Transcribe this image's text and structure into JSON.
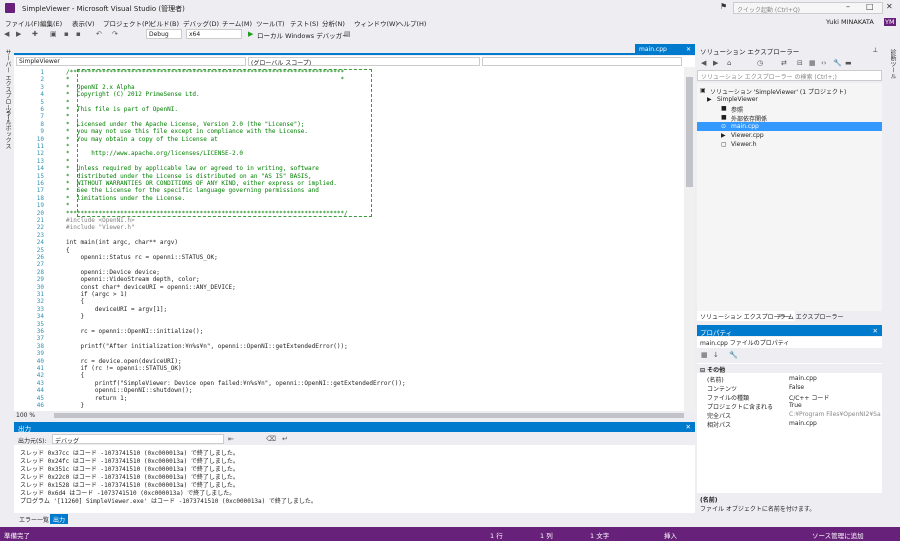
{
  "window": {
    "title": "SimpleViewer - Microsoft Visual Studio (管理者)",
    "quick_launch": "クイック起動 (Ctrl+Q)",
    "user": "Yuki MINAKATA",
    "user_initials": "YM"
  },
  "menu": [
    "ファイル(F)",
    "編集(E)",
    "表示(V)",
    "プロジェクト(P)",
    "ビルド(B)",
    "デバッグ(D)",
    "チーム(M)",
    "ツール(T)",
    "テスト(S)",
    "分析(N)",
    "ウィンドウ(W)",
    "ヘルプ(H)"
  ],
  "toolbar": {
    "config": "Debug",
    "platform": "x64",
    "run": "ローカル Windows デバッガー"
  },
  "left_strip": [
    "サーバー エクスプローラー",
    "ツールボックス"
  ],
  "right_strip": [
    "診断ツール"
  ],
  "editor": {
    "tab": "main.cpp",
    "nav_project": "SimpleViewer",
    "nav_scope": "(グローバル スコープ)",
    "zoom": "100 %"
  },
  "code_lines": [
    {
      "n": "1",
      "t": "/****************************************************************************",
      "c": "cmt"
    },
    {
      "n": "2",
      "t": "*                                                                           *",
      "c": "cmt"
    },
    {
      "n": "3",
      "t": "*  OpenNI 2.x Alpha",
      "c": "cmt"
    },
    {
      "n": "4",
      "t": "*  Copyright (C) 2012 PrimeSense Ltd.",
      "c": "cmt"
    },
    {
      "n": "5",
      "t": "*",
      "c": "cmt"
    },
    {
      "n": "6",
      "t": "*  This file is part of OpenNI.",
      "c": "cmt"
    },
    {
      "n": "7",
      "t": "*",
      "c": "cmt"
    },
    {
      "n": "8",
      "t": "*  Licensed under the Apache License, Version 2.0 (the \"License\");",
      "c": "cmt"
    },
    {
      "n": "9",
      "t": "*  you may not use this file except in compliance with the License.",
      "c": "cmt"
    },
    {
      "n": "10",
      "t": "*  You may obtain a copy of the License at",
      "c": "cmt"
    },
    {
      "n": "11",
      "t": "*",
      "c": "cmt"
    },
    {
      "n": "12",
      "t": "*      http://www.apache.org/licenses/LICENSE-2.0",
      "c": "cmt"
    },
    {
      "n": "13",
      "t": "*",
      "c": "cmt"
    },
    {
      "n": "14",
      "t": "*  Unless required by applicable law or agreed to in writing, software",
      "c": "cmt"
    },
    {
      "n": "15",
      "t": "*  distributed under the License is distributed on an \"AS IS\" BASIS,",
      "c": "cmt"
    },
    {
      "n": "16",
      "t": "*  WITHOUT WARRANTIES OR CONDITIONS OF ANY KIND, either express or implied.",
      "c": "cmt"
    },
    {
      "n": "17",
      "t": "*  See the License for the specific language governing permissions and",
      "c": "cmt"
    },
    {
      "n": "18",
      "t": "*  limitations under the License.",
      "c": "cmt"
    },
    {
      "n": "19",
      "t": "*",
      "c": "cmt"
    },
    {
      "n": "20",
      "t": "*****************************************************************************/",
      "c": "cmt"
    },
    {
      "n": "21",
      "t": "#include <OpenNI.h>",
      "c": "pp"
    },
    {
      "n": "22",
      "t": "#include \"Viewer.h\"",
      "c": "pp"
    },
    {
      "n": "23",
      "t": "",
      "c": ""
    },
    {
      "n": "24",
      "t": "int main(int argc, char** argv)",
      "c": ""
    },
    {
      "n": "25",
      "t": "{",
      "c": ""
    },
    {
      "n": "26",
      "t": "    openni::Status rc = openni::STATUS_OK;",
      "c": ""
    },
    {
      "n": "27",
      "t": "",
      "c": ""
    },
    {
      "n": "28",
      "t": "    openni::Device device;",
      "c": ""
    },
    {
      "n": "29",
      "t": "    openni::VideoStream depth, color;",
      "c": ""
    },
    {
      "n": "30",
      "t": "    const char* deviceURI = openni::ANY_DEVICE;",
      "c": ""
    },
    {
      "n": "31",
      "t": "    if (argc > 1)",
      "c": ""
    },
    {
      "n": "32",
      "t": "    {",
      "c": ""
    },
    {
      "n": "33",
      "t": "        deviceURI = argv[1];",
      "c": ""
    },
    {
      "n": "34",
      "t": "    }",
      "c": ""
    },
    {
      "n": "35",
      "t": "",
      "c": ""
    },
    {
      "n": "36",
      "t": "    rc = openni::OpenNI::initialize();",
      "c": ""
    },
    {
      "n": "37",
      "t": "",
      "c": ""
    },
    {
      "n": "38",
      "t": "    printf(\"After initialization:¥n%s¥n\", openni::OpenNI::getExtendedError());",
      "c": ""
    },
    {
      "n": "39",
      "t": "",
      "c": ""
    },
    {
      "n": "40",
      "t": "    rc = device.open(deviceURI);",
      "c": ""
    },
    {
      "n": "41",
      "t": "    if (rc != openni::STATUS_OK)",
      "c": ""
    },
    {
      "n": "42",
      "t": "    {",
      "c": ""
    },
    {
      "n": "43",
      "t": "        printf(\"SimpleViewer: Device open failed:¥n%s¥n\", openni::OpenNI::getExtendedError());",
      "c": ""
    },
    {
      "n": "44",
      "t": "        openni::OpenNI::shutdown();",
      "c": ""
    },
    {
      "n": "45",
      "t": "        return 1;",
      "c": ""
    },
    {
      "n": "46",
      "t": "    }",
      "c": ""
    }
  ],
  "output": {
    "title": "出力",
    "source_label": "出力元(S):",
    "source": "デバッグ",
    "lines": [
      "スレッド 0x37cc はコード -1073741510 (0xc000013a) で終了しました。",
      "スレッド 0x24fc はコード -1073741510 (0xc000013a) で終了しました。",
      "スレッド 0x351c はコード -1073741510 (0xc000013a) で終了しました。",
      "スレッド 0x22c0 はコード -1073741510 (0xc000013a) で終了しました。",
      "スレッド 0x1528 はコード -1073741510 (0xc000013a) で終了しました。",
      "スレッド 0x6d4 はコード -1073741510 (0xc000013a) で終了しました。",
      "プログラム '[11260] SimpleViewer.exe' はコード -1073741510 (0xc000013a) で終了しました。"
    ]
  },
  "bottom_tabs": [
    "エラー一覧",
    "出力"
  ],
  "solution_explorer": {
    "title": "ソリューション エクスプローラー",
    "search": "ソリューション エクスプローラー の検索 (Ctrl+;)",
    "items": [
      {
        "label": "ソリューション 'SimpleViewer' (1 プロジェクト)",
        "indent": 0
      },
      {
        "label": "SimpleViewer",
        "indent": 1
      },
      {
        "label": "参照",
        "indent": 2
      },
      {
        "label": "外部依存関係",
        "indent": 2
      },
      {
        "label": "main.cpp",
        "indent": 2
      },
      {
        "label": "Viewer.cpp",
        "indent": 2
      },
      {
        "label": "Viewer.h",
        "indent": 2
      }
    ],
    "tabs": [
      "ソリューション エクスプローラー",
      "チーム エクスプローラー"
    ]
  },
  "properties": {
    "title": "プロパティ",
    "selected": "main.cpp ファイルのプロパティ",
    "category": "その他",
    "rows": [
      {
        "k": "(名前)",
        "v": "main.cpp"
      },
      {
        "k": "コンテンツ",
        "v": "False"
      },
      {
        "k": "ファイルの種類",
        "v": "C/C++ コード"
      },
      {
        "k": "プロジェクトに含まれる",
        "v": "True"
      },
      {
        "k": "完全パス",
        "v": "C:¥Program Files¥OpenNI2¥Samp"
      },
      {
        "k": "相対パス",
        "v": "main.cpp"
      }
    ],
    "desc_title": "(名前)",
    "desc": "ファイル オブジェクトに名前を付けます。"
  },
  "status": {
    "ready": "準備完了",
    "line": "1 行",
    "col": "1 列",
    "char": "1 文字",
    "mode": "挿入",
    "vcs": "ソース管理に追加"
  }
}
